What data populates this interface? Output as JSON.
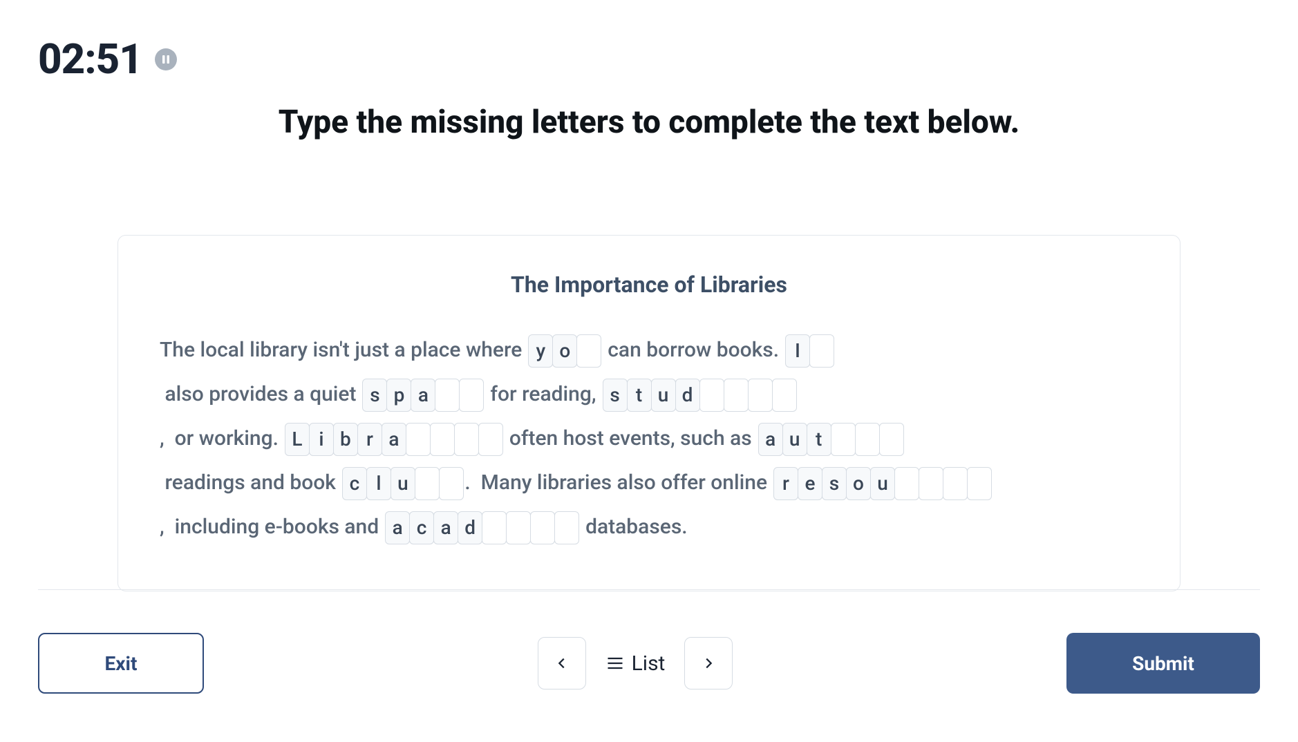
{
  "timer": "02:51",
  "instruction": "Type the missing letters to complete the text below.",
  "card": {
    "title": "The Importance of Libraries",
    "segments": [
      {
        "type": "text",
        "value": "The local library isn't just a place where "
      },
      {
        "type": "blank",
        "prefill": [
          "y",
          "o"
        ],
        "empty": 1,
        "name": "blank-you"
      },
      {
        "type": "text",
        "value": " can borrow books. "
      },
      {
        "type": "blank",
        "prefill": [
          "I"
        ],
        "empty": 1,
        "name": "blank-it"
      },
      {
        "type": "text",
        "value": " also provides a quiet "
      },
      {
        "type": "blank",
        "prefill": [
          "s",
          "p",
          "a"
        ],
        "empty": 2,
        "name": "blank-space"
      },
      {
        "type": "text",
        "value": " for reading, "
      },
      {
        "type": "blank",
        "prefill": [
          "s",
          "t",
          "u",
          "d"
        ],
        "empty": 4,
        "name": "blank-studying"
      },
      {
        "type": "text",
        "value": ",  or working. "
      },
      {
        "type": "blank",
        "prefill": [
          "L",
          "i",
          "b",
          "r",
          "a"
        ],
        "empty": 4,
        "name": "blank-libraries"
      },
      {
        "type": "text",
        "value": " often host events, such as "
      },
      {
        "type": "blank",
        "prefill": [
          "a",
          "u",
          "t"
        ],
        "empty": 3,
        "name": "blank-author"
      },
      {
        "type": "text",
        "value": " readings and book "
      },
      {
        "type": "blank",
        "prefill": [
          "c",
          "l",
          "u"
        ],
        "empty": 2,
        "name": "blank-clubs"
      },
      {
        "type": "text",
        "value": ".  Many libraries also offer online "
      },
      {
        "type": "blank",
        "prefill": [
          "r",
          "e",
          "s",
          "o",
          "u"
        ],
        "empty": 4,
        "name": "blank-resources"
      },
      {
        "type": "text",
        "value": ",  including e-books and "
      },
      {
        "type": "blank",
        "prefill": [
          "a",
          "c",
          "a",
          "d"
        ],
        "empty": 4,
        "name": "blank-academic"
      },
      {
        "type": "text",
        "value": " databases."
      }
    ]
  },
  "footer": {
    "exit": "Exit",
    "list": "List",
    "submit": "Submit"
  }
}
